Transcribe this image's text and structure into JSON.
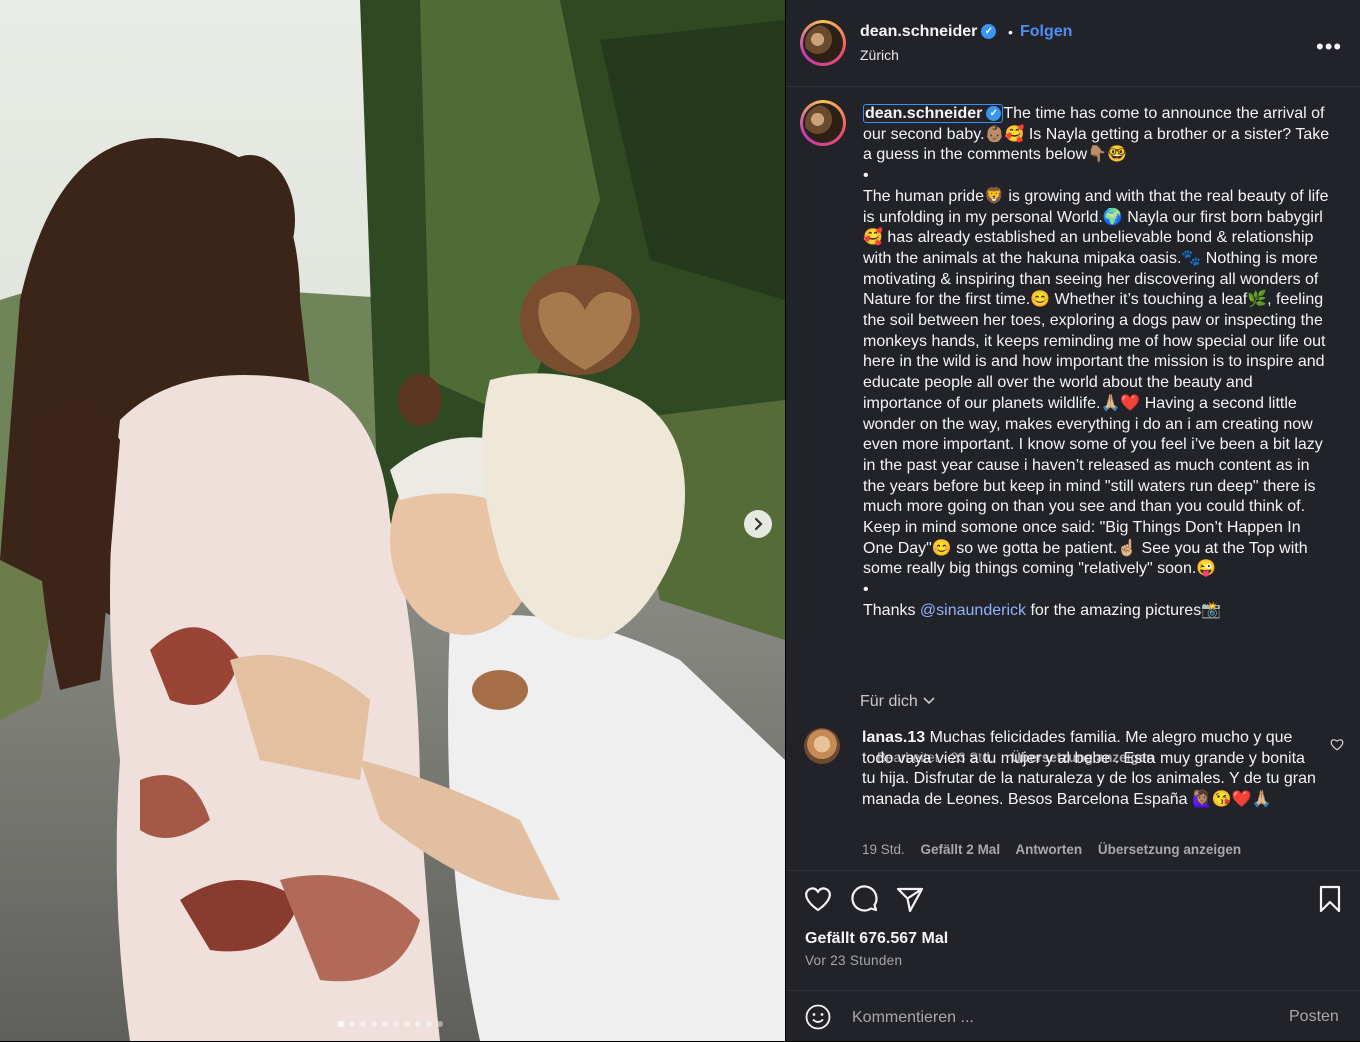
{
  "post": {
    "username": "dean.schneider",
    "follow_label": "Folgen",
    "separator": "•",
    "location": "Zürich",
    "more_label": "•••"
  },
  "caption": {
    "username": "dean.schneider",
    "text_part1": "The time has come to announce the arrival of our second baby.👶🏽🥰 Is Nayla getting a brother or a sister? Take a guess in the comments below👇🏽🤓\n•\nThe human pride🦁 is growing and with that the real beauty of life is unfolding in my personal World.🌍 Nayla our first born babygirl🥰 has already established an unbelievable bond & relationship with the animals at the hakuna mipaka oasis.🐾 Nothing is more motivating & inspiring than seeing her discovering all wonders of Nature for the first time.😊 Whether it’s touching a leaf🌿, feeling the soil between her toes, exploring a dogs paw or inspecting the monkeys hands, it keeps reminding me of how special our life out here in the wild is and how important the mission is to inspire and educate people all over the world about the beauty and importance of our planets wildlife.🙏🏼❤️ Having a second little wonder on the way, makes everything i do an i am creating now even more important. I know some of you feel i’ve been a bit lazy in the past year cause i haven’t released as much content as in the years before but keep in mind \"still waters run deep\" there is much more going on than you see and than you could think of. Keep in mind somone once said: \"Big Things Don’t Happen In One Day\"😊 so we gotta be patient.☝🏼 See you at the Top with some really big things coming \"relatively\" soon.😜\n•\nThanks ",
    "mention": "@sinaunderick",
    "text_part2": " for the amazing pictures📸",
    "edited": "Bearbeitet · 23 Std.",
    "translate": "Übersetzung anzeigen"
  },
  "comments_filter": "Für dich",
  "comment": {
    "username": "lanas.13",
    "text": "Muchas felicidades familia. Me alegro mucho y que todo vaya vien a tu mujer y al bebe . Esta muy grande y bonita tu hija. Disfrutar de la naturaleza y de los animales. Y de tu gran manada de Leones. Besos Barcelona España 🙋🏽‍♀️😘❤️🙏🏼",
    "time": "19 Std.",
    "likes": "Gefällt 2 Mal",
    "reply": "Antworten",
    "translate": "Übersetzung anzeigen"
  },
  "engagement": {
    "likes": "Gefällt 676.567 Mal",
    "time_ago": "Vor 23 Stunden"
  },
  "composer": {
    "placeholder": "Kommentieren ...",
    "post_label": "Posten"
  },
  "carousel": {
    "total": 10,
    "active_index": 0
  },
  "icons": [
    "heart-icon",
    "comment-icon",
    "share-icon",
    "bookmark-icon",
    "emoji-icon",
    "chevron-right-icon",
    "chevron-down-icon",
    "verified-icon",
    "more-icon"
  ],
  "colors": {
    "panel_bg": "#212328",
    "link_blue": "#4f8df9",
    "verified_blue": "#3797f0",
    "muted": "#a8a8a8"
  }
}
